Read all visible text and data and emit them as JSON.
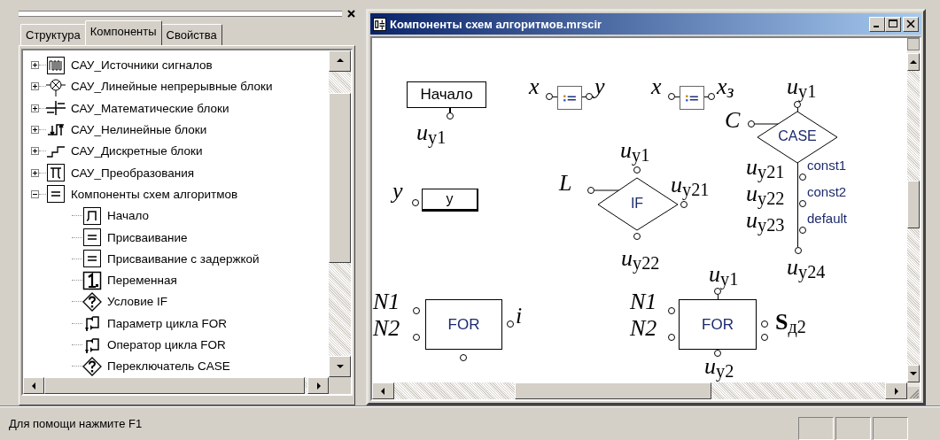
{
  "panel": {
    "tabs": [
      {
        "label": "Структура",
        "selected": false
      },
      {
        "label": "Компоненты",
        "selected": true
      },
      {
        "label": "Свойства",
        "selected": false
      }
    ]
  },
  "tree": {
    "items": [
      {
        "label": "САУ_Источники сигналов",
        "expanded": false
      },
      {
        "label": "САУ_Линейные непрерывные блоки",
        "expanded": false
      },
      {
        "label": "САУ_Математические блоки",
        "expanded": false
      },
      {
        "label": "САУ_Нелинейные блоки",
        "expanded": false
      },
      {
        "label": "САУ_Дискретные блоки",
        "expanded": false
      },
      {
        "label": "САУ_Преобразования",
        "expanded": false
      },
      {
        "label": "Компоненты схем алгоритмов",
        "expanded": true,
        "children": [
          {
            "label": "Начало"
          },
          {
            "label": "Присваивание"
          },
          {
            "label": "Присваивание с задержкой"
          },
          {
            "label": "Переменная"
          },
          {
            "label": "Условие IF"
          },
          {
            "label": "Параметр цикла FOR"
          },
          {
            "label": "Оператор цикла FOR"
          },
          {
            "label": "Переключатель CASE"
          }
        ]
      }
    ]
  },
  "document": {
    "title": "Компоненты схем алгоритмов.mrscir",
    "blocks": [
      {
        "kind": "start",
        "label": "Начало",
        "output": "*u*$_{у1}$"
      },
      {
        "kind": "assign",
        "input": "x",
        "output": "y"
      },
      {
        "kind": "assign",
        "input": "x",
        "output": "*x*$_{з}$"
      },
      {
        "kind": "variable",
        "label": "y",
        "name": "y"
      },
      {
        "kind": "if",
        "label": "IF",
        "condition": "L",
        "input": "*u*$_{у1}$",
        "true_output": "*u*$_{у21}$",
        "false_output": "*u*$_{у22}$"
      },
      {
        "kind": "case",
        "label": "CASE",
        "selector": "C",
        "input": "*u*$_{у1}$",
        "branches": [
          {
            "output": "*u*$_{у21}$",
            "value": "const1"
          },
          {
            "output": "*u*$_{у22}$",
            "value": "const2"
          },
          {
            "output": "*u*$_{у23}$",
            "value": "default"
          }
        ],
        "output": "*u*$_{у24}$"
      },
      {
        "kind": "for_param",
        "label": "FOR",
        "from": "N1",
        "to": "N2",
        "output": "i"
      },
      {
        "kind": "for_operator",
        "label": "FOR",
        "from": "N1",
        "to": "N2",
        "input": "*u*$_{у1}$",
        "output": "*u*$_{у2}$",
        "sum": "**S**$_{д2}$"
      }
    ]
  },
  "status_bar": {
    "text": "Для помощи нажмите F1"
  }
}
